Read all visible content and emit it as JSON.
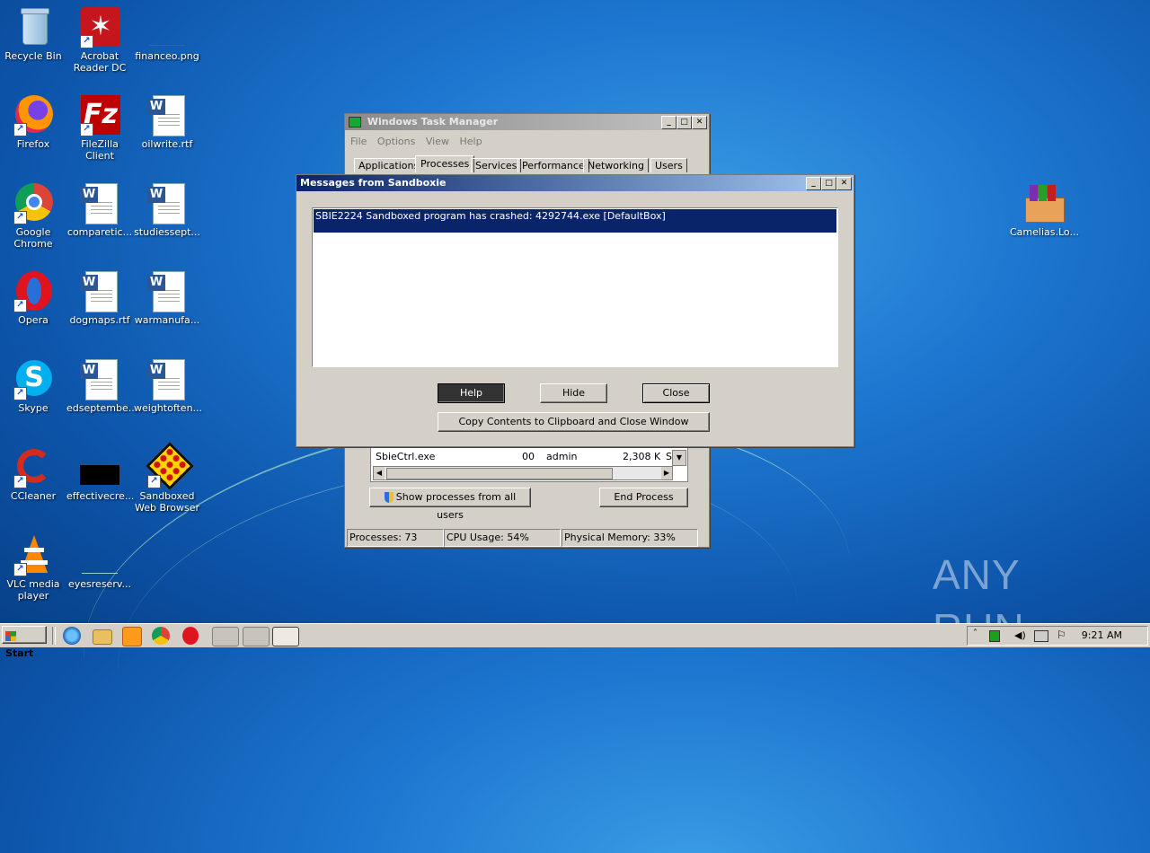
{
  "desktop": {
    "icons": [
      {
        "label": "Recycle Bin",
        "icon": "recycle-bin-icon"
      },
      {
        "label": "Acrobat Reader DC",
        "icon": "acrobat-icon"
      },
      {
        "label": "financeo.png",
        "icon": "image-file-icon"
      },
      {
        "label": "Firefox",
        "icon": "firefox-icon"
      },
      {
        "label": "FileZilla Client",
        "icon": "filezilla-icon"
      },
      {
        "label": "oilwrite.rtf",
        "icon": "word-doc-icon"
      },
      {
        "label": "Google Chrome",
        "icon": "chrome-icon"
      },
      {
        "label": "comparetic...",
        "icon": "word-doc-icon"
      },
      {
        "label": "studiessept...",
        "icon": "word-doc-icon"
      },
      {
        "label": "Opera",
        "icon": "opera-icon"
      },
      {
        "label": "dogmaps.rtf",
        "icon": "word-doc-icon"
      },
      {
        "label": "warmanufa...",
        "icon": "word-doc-icon"
      },
      {
        "label": "Skype",
        "icon": "skype-icon"
      },
      {
        "label": "edseptembe...",
        "icon": "word-doc-icon"
      },
      {
        "label": "weightoften...",
        "icon": "word-doc-icon"
      },
      {
        "label": "CCleaner",
        "icon": "ccleaner-icon"
      },
      {
        "label": "effectivecre...",
        "icon": "black-file-icon"
      },
      {
        "label": "Sandboxed Web Browser",
        "icon": "sandboxie-icon"
      },
      {
        "label": "VLC media player",
        "icon": "vlc-icon"
      },
      {
        "label": "eyesreserv...",
        "icon": "file-icon"
      },
      {
        "label": "Camelias.Lo...",
        "icon": "winrar-icon"
      }
    ]
  },
  "task_manager": {
    "title": "Windows Task Manager",
    "menu": [
      "File",
      "Options",
      "View",
      "Help"
    ],
    "tabs": [
      "Applications",
      "Processes",
      "Services",
      "Performance",
      "Networking",
      "Users"
    ],
    "active_tab": "Processes",
    "row": {
      "name": "SbieCtrl.exe",
      "cpu": "00",
      "user": "admin",
      "mem": "2,308 K",
      "desc": "Sa"
    },
    "show_all_label": "Show processes from all users",
    "end_process_label": "End Process",
    "status": {
      "processes": "Processes: 73",
      "cpu": "CPU Usage: 54%",
      "memory": "Physical Memory: 33%"
    }
  },
  "sandboxie_dialog": {
    "title": "Messages from Sandboxie",
    "message": "SBIE2224 Sandboxed program has crashed: 4292744.exe [DefaultBox]",
    "help_label": "Help",
    "hide_label": "Hide",
    "close_label": "Close",
    "copy_label": "Copy Contents to Clipboard and Close Window"
  },
  "taskbar": {
    "start_label": "Start",
    "clock": "9:21 AM"
  },
  "watermark": "ANY RUN"
}
